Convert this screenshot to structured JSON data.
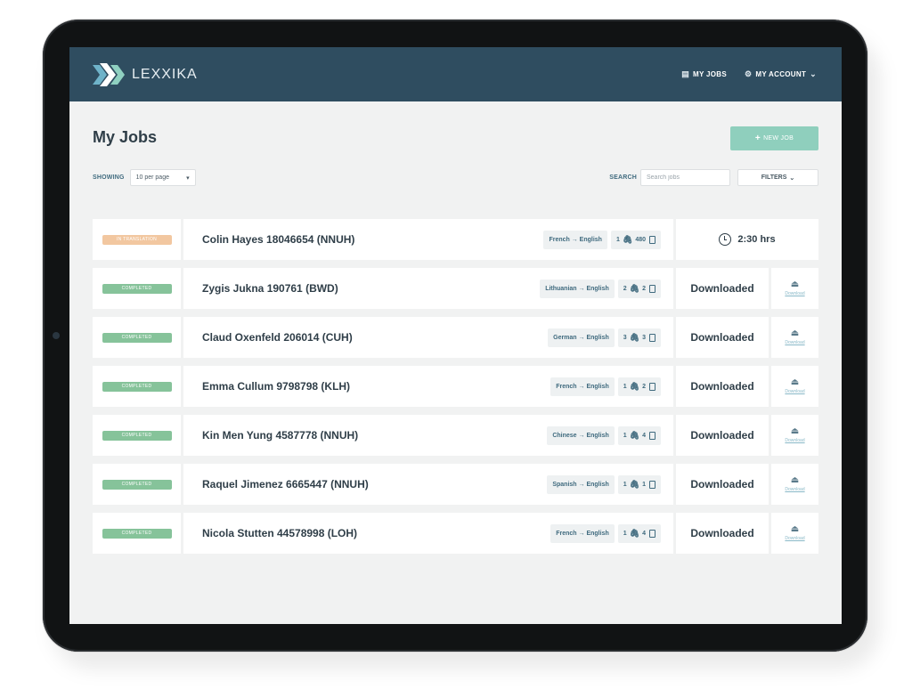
{
  "app": {
    "brand": "LEXXIKA",
    "nav": {
      "my_jobs": "MY JOBS",
      "my_account": "MY ACCOUNT"
    }
  },
  "page": {
    "title": "My Jobs",
    "new_job_label": "NEW JOB",
    "showing_label": "SHOWING",
    "per_page": "10 per page",
    "search_label": "SEARCH",
    "search_placeholder": "Search jobs",
    "filters_label": "FILTERS"
  },
  "colors": {
    "header": "#2f4d60",
    "in_translation": "#f2c7a0",
    "completed": "#86c39a",
    "accent": "#8fcfbd"
  },
  "jobs": [
    {
      "status": "IN TRANSLATION",
      "name": "Colin Hayes 18046654 (NNUH)",
      "languages": "French → English",
      "attachments": "1",
      "pages": "480",
      "time": "2:30 hrs"
    },
    {
      "status": "COMPLETED",
      "name": "Zygis Jukna 190761 (BWD)",
      "languages": "Lithuanian → English",
      "attachments": "2",
      "pages": "2",
      "result": "Downloaded",
      "download": "Download"
    },
    {
      "status": "COMPLETED",
      "name": "Claud Oxenfeld 206014 (CUH)",
      "languages": "German → English",
      "attachments": "3",
      "pages": "3",
      "result": "Downloaded",
      "download": "Download"
    },
    {
      "status": "COMPLETED",
      "name": "Emma Cullum 9798798 (KLH)",
      "languages": "French → English",
      "attachments": "1",
      "pages": "2",
      "result": "Downloaded",
      "download": "Download"
    },
    {
      "status": "COMPLETED",
      "name": "Kin Men Yung 4587778 (NNUH)",
      "languages": "Chinese → English",
      "attachments": "1",
      "pages": "4",
      "result": "Downloaded",
      "download": "Download"
    },
    {
      "status": "COMPLETED",
      "name": "Raquel Jimenez 6665447 (NNUH)",
      "languages": "Spanish → English",
      "attachments": "1",
      "pages": "1",
      "result": "Downloaded",
      "download": "Download"
    },
    {
      "status": "COMPLETED",
      "name": "Nicola Stutten 44578998 (LOH)",
      "languages": "French → English",
      "attachments": "1",
      "pages": "4",
      "result": "Downloaded",
      "download": "Download"
    }
  ]
}
